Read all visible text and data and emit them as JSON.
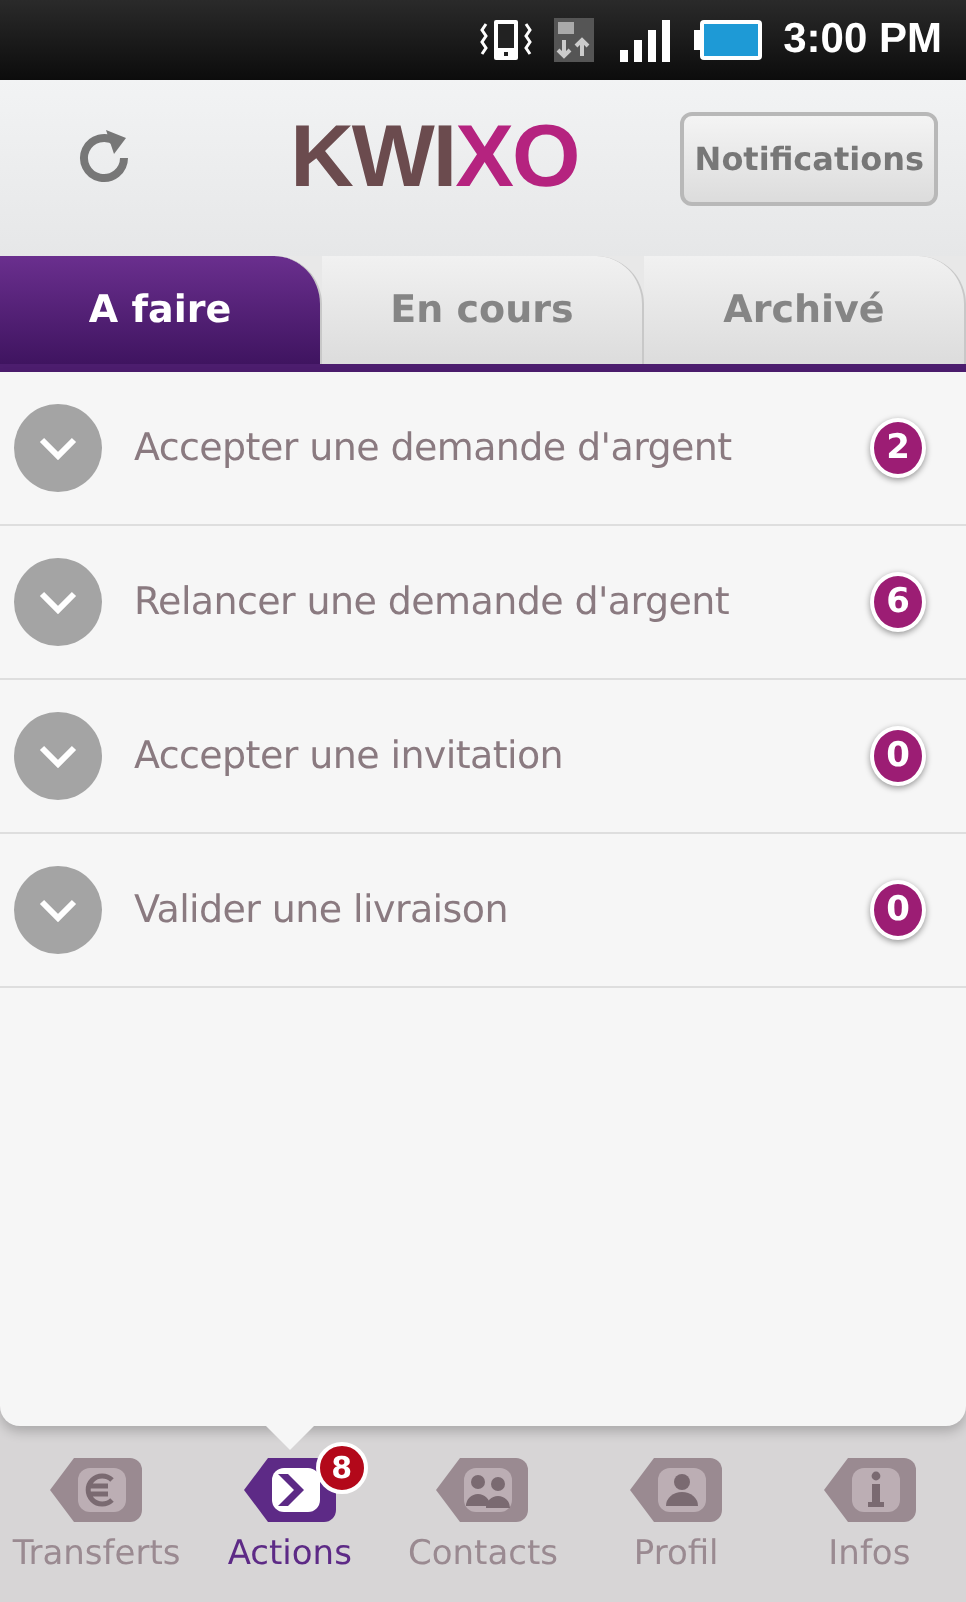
{
  "status_bar": {
    "time": "3:00 PM"
  },
  "header": {
    "logo_parts": [
      "KWI",
      "XO"
    ],
    "notifications_button": "Notifications"
  },
  "tabs": [
    {
      "label": "A faire",
      "selected": true
    },
    {
      "label": "En cours",
      "selected": false
    },
    {
      "label": "Archivé",
      "selected": false
    }
  ],
  "actions": [
    {
      "label": "Accepter une demande d'argent",
      "count": "2"
    },
    {
      "label": "Relancer une demande d'argent",
      "count": "6"
    },
    {
      "label": "Accepter une invitation",
      "count": "0"
    },
    {
      "label": "Valider une livraison",
      "count": "0"
    }
  ],
  "bottom_nav": [
    {
      "label": "Transferts",
      "kind": "euro",
      "selected": false
    },
    {
      "label": "Actions",
      "kind": "chevron",
      "selected": true,
      "badge": "8"
    },
    {
      "label": "Contacts",
      "kind": "people",
      "selected": false
    },
    {
      "label": "Profil",
      "kind": "person",
      "selected": false
    },
    {
      "label": "Infos",
      "kind": "info",
      "selected": false
    }
  ]
}
